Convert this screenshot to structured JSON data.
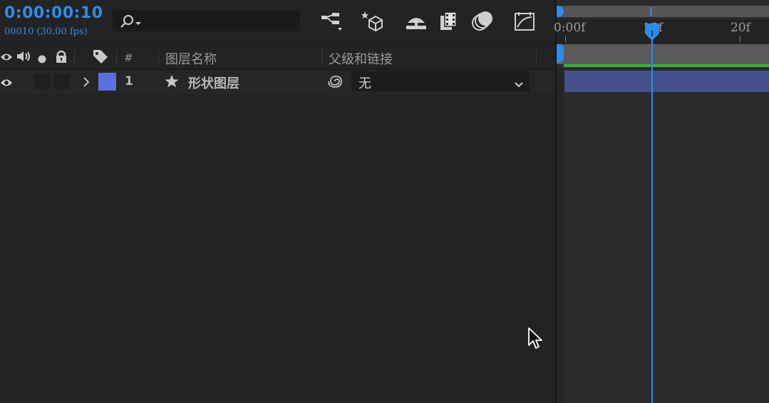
{
  "timeline": {
    "timecode": "0:00:00:10",
    "frame_info": "00010 (30.00 fps)",
    "search": {
      "placeholder": ""
    }
  },
  "toolbar": {
    "icons": [
      "comp-flowchart-icon",
      "draft-3d-icon",
      "hide-shy-layers-icon",
      "frame-blending-icon",
      "motion-blur-icon",
      "graph-editor-icon"
    ]
  },
  "columns": {
    "number": "#",
    "layer_name": "图层名称",
    "parent_link": "父级和链接"
  },
  "layers": [
    {
      "number": "1",
      "name": "形状图层",
      "label_color": "#5b6fe0",
      "parent": "无"
    }
  ],
  "ruler": {
    "ticks": [
      "0:00f",
      "10f",
      "20f"
    ]
  },
  "colors": {
    "accent": "#2d8ceb",
    "layer_bar": "#46508a",
    "work_area_green": "#2fb52f"
  }
}
